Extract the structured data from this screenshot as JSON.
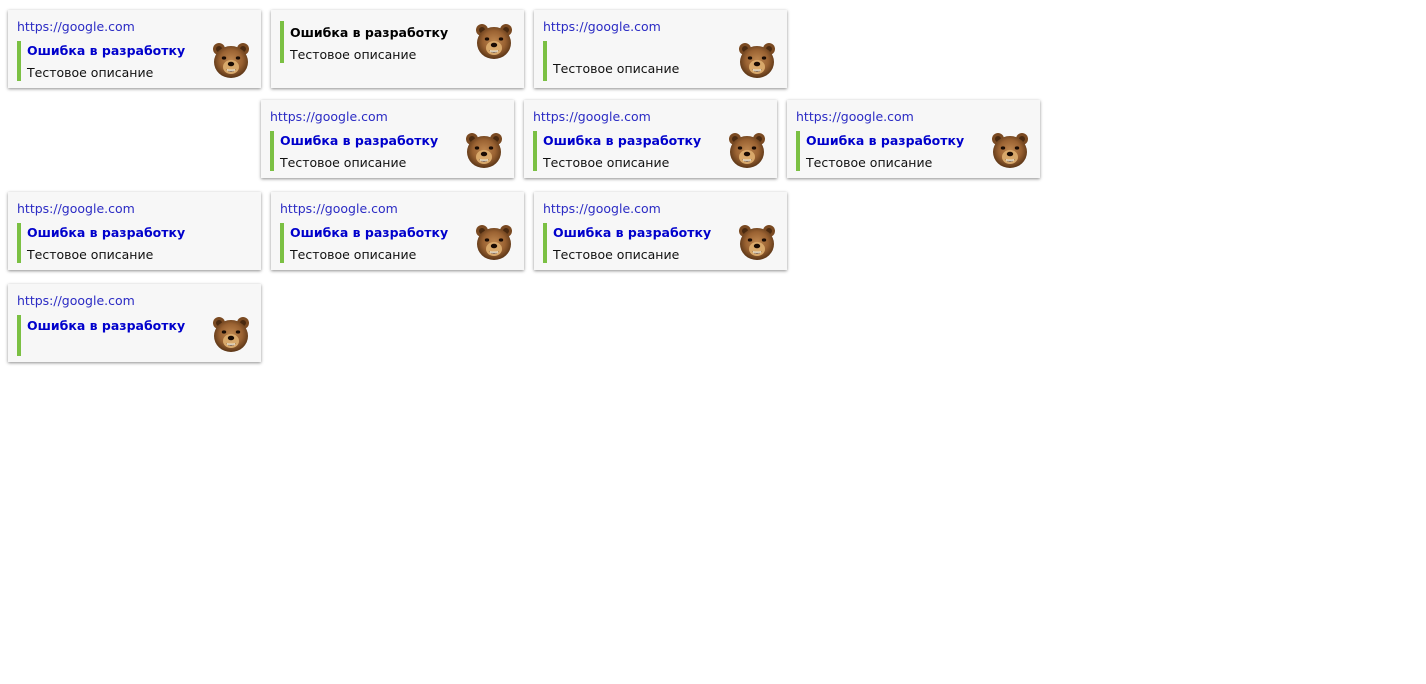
{
  "cards": [
    {
      "url": "https://google.com",
      "title": "Ошибка в разработку",
      "description": "Тестовое описание",
      "avatar_icon": "bear-icon"
    },
    {
      "title": "Ошибка в разработку",
      "description": "Тестовое описание",
      "avatar_icon": "bear-icon"
    },
    {
      "url": "https://google.com",
      "description": "Тестовое описание",
      "avatar_icon": "bear-icon"
    },
    {
      "url": "https://google.com",
      "title": "Ошибка в разработку",
      "description": "Тестовое описание",
      "avatar_icon": "bear-icon"
    },
    {
      "url": "https://google.com",
      "title": "Ошибка в разработку",
      "description": "Тестовое описание",
      "avatar_icon": "bear-icon"
    },
    {
      "url": "https://google.com",
      "title": "Ошибка в разработку",
      "description": "Тестовое описание",
      "avatar_icon": "bear-icon"
    },
    {
      "url": "https://google.com",
      "title": "Ошибка в разработку",
      "description": "Тестовое описание",
      "avatar_icon": "bear-icon"
    },
    {
      "url": "https://google.com",
      "title": "Ошибка в разработку",
      "description": "Тестовое описание",
      "avatar_icon": "bear-icon"
    },
    {
      "url": "https://google.com",
      "title": "Ошибка в разработку",
      "description": "Тестовое описание",
      "avatar_icon": "bear-icon"
    },
    {
      "url": "https://google.com",
      "title": "Ошибка в разработку",
      "avatar_icon": "bear-icon"
    }
  ],
  "colors": {
    "url": "#2b2bc4",
    "title_link": "#0000cc",
    "title_plain": "#000000",
    "accent_bar": "#7bc043",
    "card_background": "#f7f7f7"
  }
}
